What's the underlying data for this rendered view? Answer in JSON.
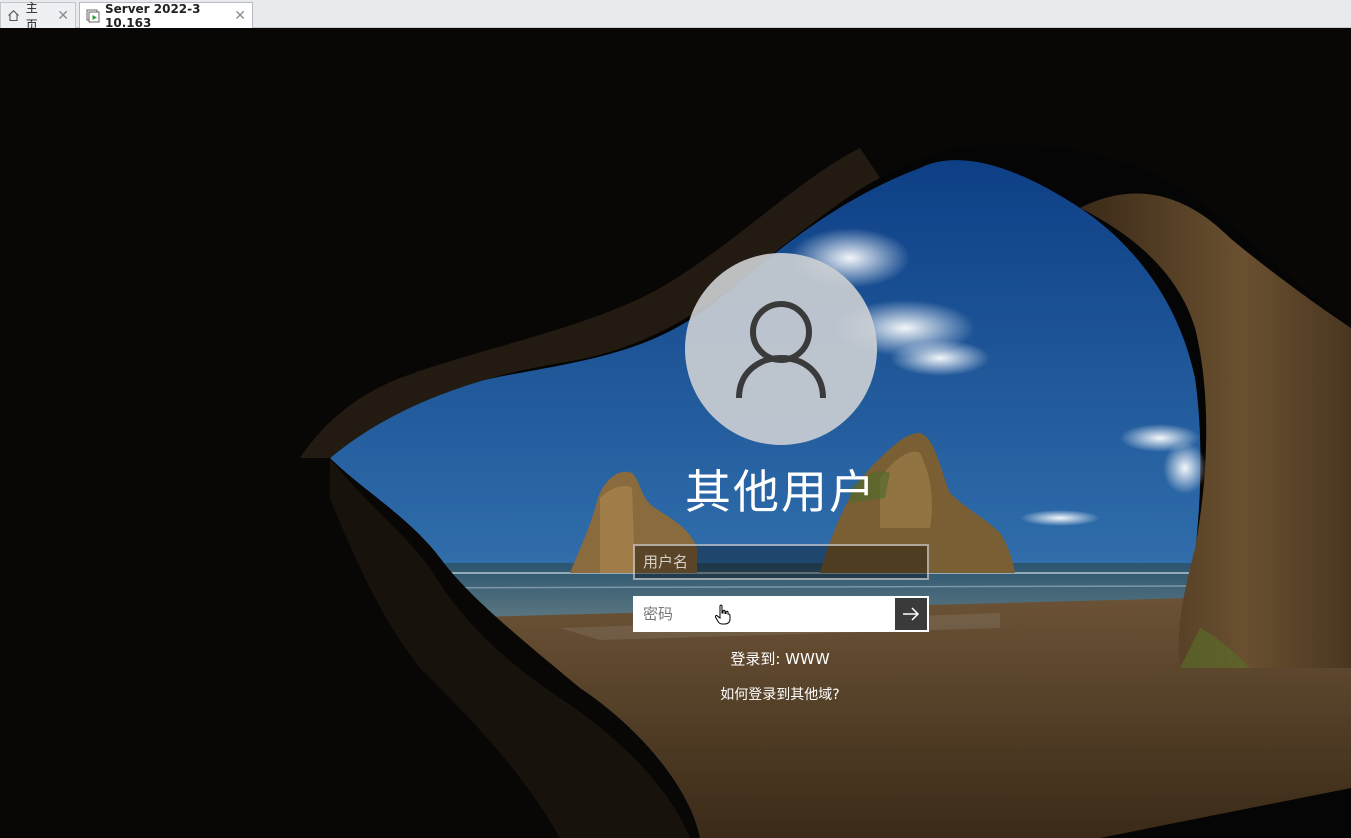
{
  "tabs": [
    {
      "label": "主页",
      "icon": "home-icon"
    },
    {
      "label": "Server 2022-3 10.163",
      "icon": "vm-running-icon"
    }
  ],
  "login": {
    "user_title": "其他用户",
    "username_placeholder": "用户名",
    "password_placeholder": "密码",
    "signin_to": "登录到: WWW",
    "other_domain_link": "如何登录到其他域?",
    "submit_icon": "arrow-right-icon"
  },
  "colors": {
    "sky": "#1f5a9a",
    "rock": "#5a4326",
    "sand": "#7a5a32",
    "avatar_bg": "#cdd0d4"
  }
}
